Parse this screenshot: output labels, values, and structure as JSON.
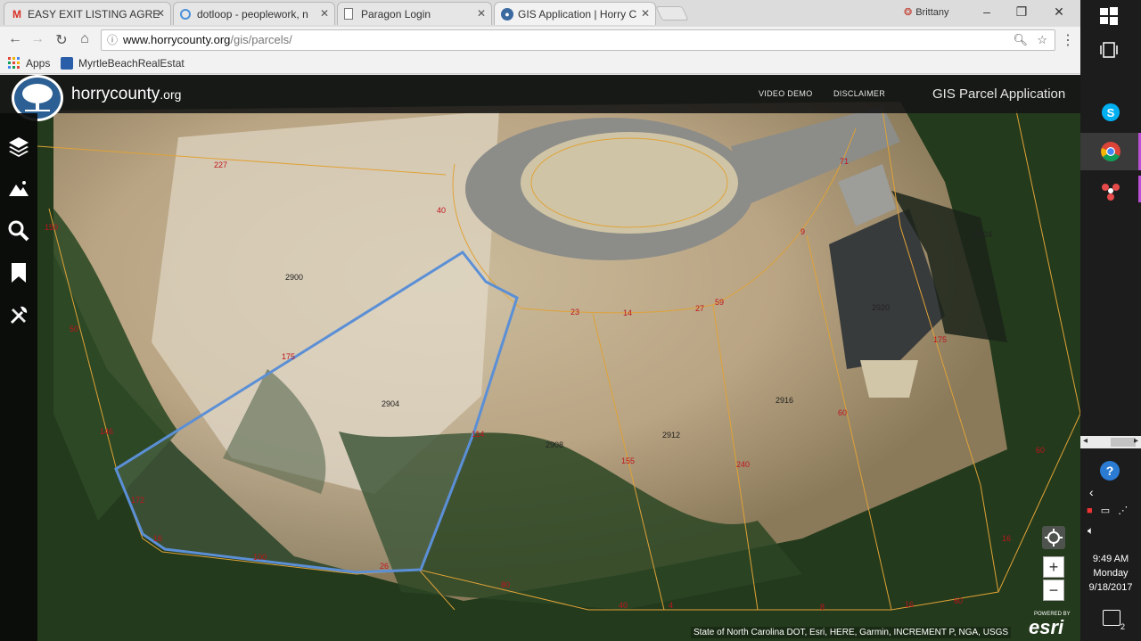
{
  "tabs": [
    {
      "label": "EASY EXIT LISTING AGRE",
      "icon": "gmail-icon"
    },
    {
      "label": "dotloop - peoplework, n",
      "icon": "dotloop-icon"
    },
    {
      "label": "Paragon Login",
      "icon": "document-icon"
    },
    {
      "label": "GIS Application | Horry C",
      "icon": "globe-icon"
    }
  ],
  "user_name": "Brittany",
  "url": {
    "host": "www.horrycounty.org",
    "path": "/gis/parcels/"
  },
  "bookmarks": [
    {
      "label": "Apps",
      "icon": "apps-grid-icon"
    },
    {
      "label": "MyrtleBeachRealEstat",
      "icon": "bookmark-shield-icon"
    }
  ],
  "app": {
    "logo_text": "horrycounty",
    "logo_tld": ".org",
    "nav_links": [
      "VIDEO DEMO",
      "DISCLAIMER"
    ],
    "title": "GIS Parcel Application"
  },
  "sidebar": [
    "layers-icon",
    "basemap-icon",
    "search-icon",
    "bookmark-icon",
    "tools-icon"
  ],
  "parcels": [
    "2900",
    "2904",
    "2908",
    "2912",
    "2916",
    "2920",
    "2924"
  ],
  "dimensions": [
    "227",
    "40",
    "23",
    "14",
    "27",
    "59",
    "71",
    "9",
    "150",
    "50",
    "146",
    "172",
    "175",
    "114",
    "155",
    "240",
    "60",
    "175",
    "60",
    "16",
    "100",
    "26",
    "80",
    "40",
    "4",
    "8",
    "16",
    "60",
    "16"
  ],
  "attribution": "State of North Carolina DOT, Esri, HERE, Garmin, INCREMENT P, NGA, USGS",
  "esri": {
    "powered": "POWERED BY",
    "brand": "esri"
  },
  "zoom": {
    "in": "+",
    "out": "−"
  },
  "taskbar_icons": [
    "windows-start-icon",
    "task-view-icon",
    "skype-icon",
    "chrome-icon",
    "pinwheel-icon"
  ],
  "clock": {
    "time": "9:49 AM",
    "day": "Monday",
    "date": "9/18/2017"
  },
  "notifications_count": "2"
}
